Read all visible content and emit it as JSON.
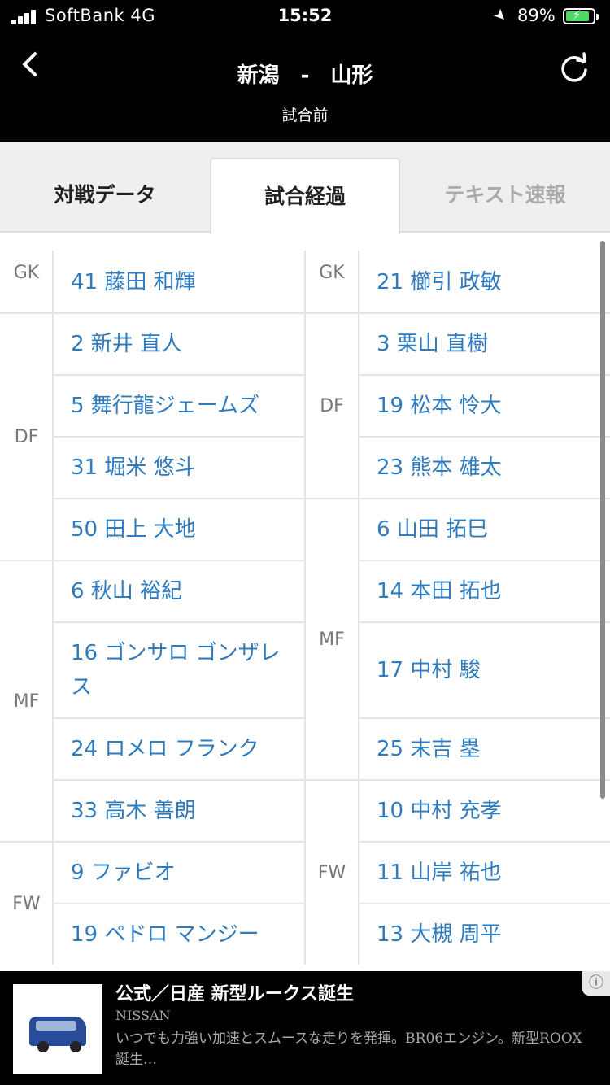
{
  "status_bar": {
    "carrier": "SoftBank  4G",
    "time": "15:52",
    "battery": "89%"
  },
  "header": {
    "title": "新潟　-　山形",
    "subtitle": "試合前"
  },
  "tabs": [
    {
      "label": "対戦データ",
      "active": false
    },
    {
      "label": "試合経過",
      "active": true
    },
    {
      "label": "テキスト速報",
      "active": false
    }
  ],
  "home": {
    "positions": [
      {
        "label": "GK"
      },
      {
        "label": "DF"
      },
      {
        "label": "MF"
      },
      {
        "label": "FW"
      }
    ],
    "players": [
      {
        "name": "41 藤田 和輝"
      },
      {
        "name": "2 新井 直人"
      },
      {
        "name": "5 舞行龍ジェームズ"
      },
      {
        "name": "31 堀米 悠斗"
      },
      {
        "name": "50 田上 大地"
      },
      {
        "name": "6 秋山 裕紀"
      },
      {
        "name": "16 ゴンサロ ゴンザレス"
      },
      {
        "name": "24 ロメロ フランク"
      },
      {
        "name": "33 高木 善朗"
      },
      {
        "name": "9 ファビオ"
      },
      {
        "name": "19 ペドロ マンジー"
      }
    ]
  },
  "away": {
    "positions": [
      {
        "label": "GK"
      },
      {
        "label": "DF"
      },
      {
        "label": "MF"
      },
      {
        "label": "FW"
      }
    ],
    "players": [
      {
        "name": "21 櫛引 政敏"
      },
      {
        "name": "3 栗山 直樹"
      },
      {
        "name": "19 松本 怜大"
      },
      {
        "name": "23 熊本 雄太"
      },
      {
        "name": "6 山田 拓巳"
      },
      {
        "name": "14 本田 拓也"
      },
      {
        "name": "17 中村 駿"
      },
      {
        "name": "25 末吉 塁"
      },
      {
        "name": "10 中村 充孝"
      },
      {
        "name": "11 山岸 祐也"
      },
      {
        "name": "13 大槻 周平"
      }
    ]
  },
  "ad": {
    "title": "公式／日産 新型ルークス誕生",
    "brand": "NISSAN",
    "description": "いつでも力強い加速とスムースな走りを発揮。BR06エンジン。新型ROOX誕生…",
    "info_icon": "info-icon"
  },
  "colors": {
    "player_link": "#2f7bbf",
    "header_bg": "#000000",
    "tab_bar_bg": "#efefef",
    "battery": "#4cd964"
  }
}
